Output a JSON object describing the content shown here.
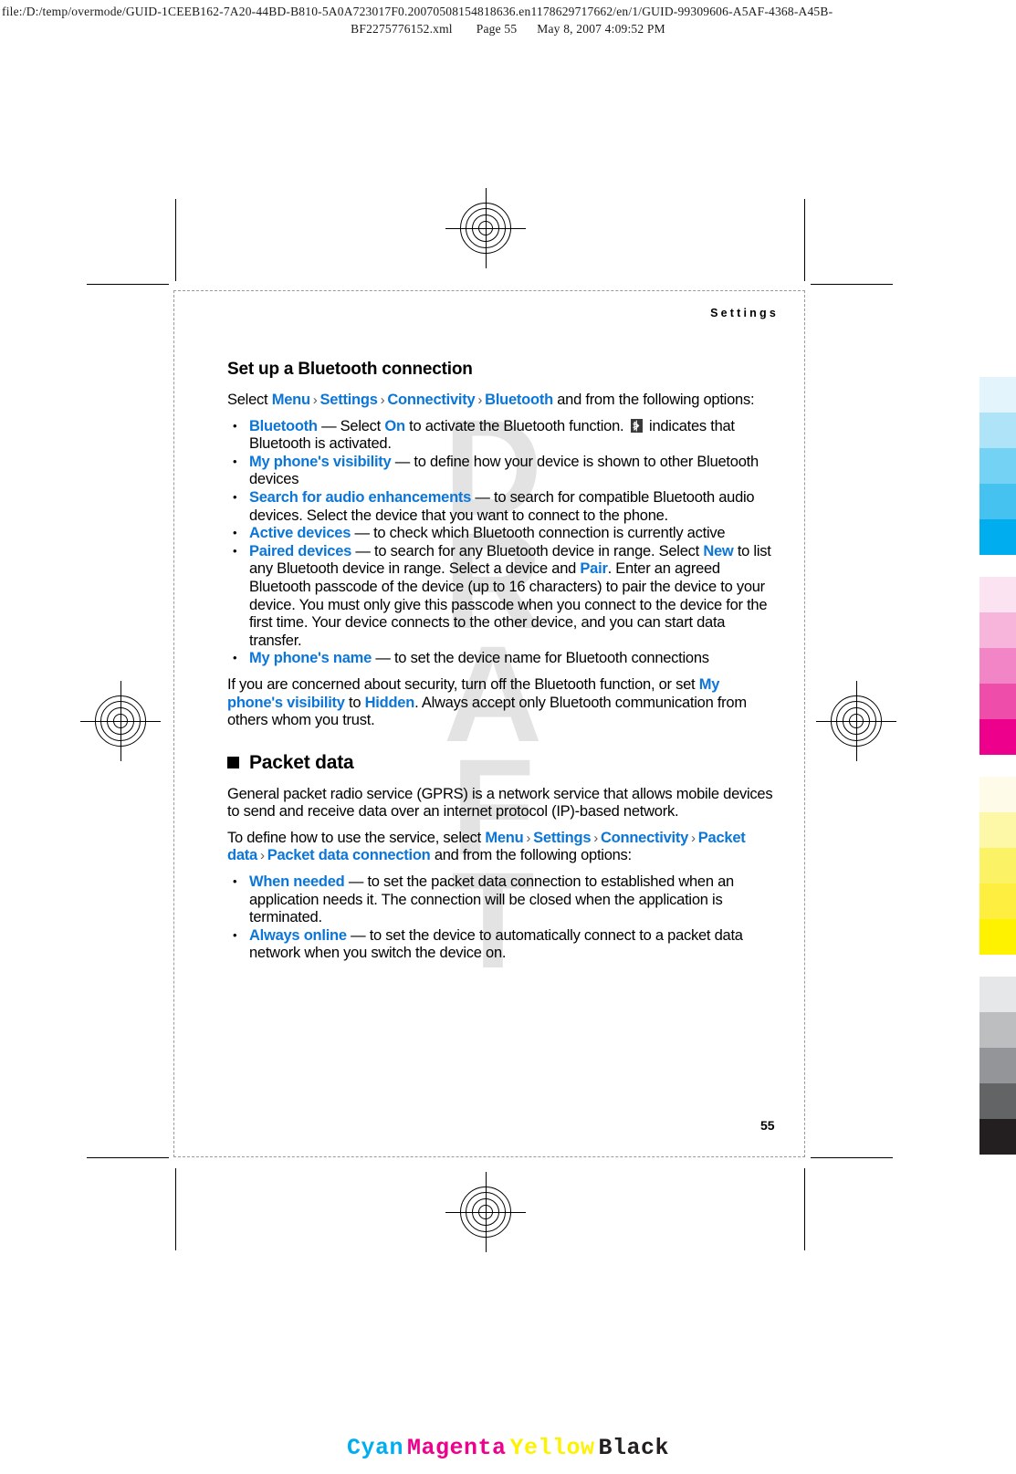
{
  "print_header": {
    "line1": "file:/D:/temp/overmode/GUID-1CEEB162-7A20-44BD-B810-5A0A723017F0.20070508154818636.en1178629717662/en/1/GUID-99309606-A5AF-4368-A45B-",
    "filename": "BF2275776152.xml",
    "page_label": "Page 55",
    "timestamp": "May 8, 2007 4:09:52 PM"
  },
  "watermark": {
    "text": "DRAFT"
  },
  "page": {
    "running_head": "Settings",
    "folio": "55",
    "section_title": "Set up a Bluetooth connection",
    "intro": {
      "prefix": "Select ",
      "path": [
        "Menu",
        "Settings",
        "Connectivity",
        "Bluetooth"
      ],
      "suffix": " and from the following options:"
    },
    "bluetooth_bullets": [
      {
        "term": "Bluetooth",
        "dash": " — ",
        "body_1": "Select ",
        "inline_key": "On",
        "body_2": " to activate the Bluetooth function. ",
        "icon": "bluetooth-icon",
        "body_3": " indicates that Bluetooth is activated."
      },
      {
        "term": "My phone's visibility",
        "dash": " — ",
        "body_1": "to define how your device is shown to other Bluetooth devices"
      },
      {
        "term": "Search for audio enhancements",
        "dash": " — ",
        "body_1": "to search for compatible Bluetooth audio devices. Select the device that you want to connect to the phone."
      },
      {
        "term": "Active devices",
        "dash": " — ",
        "body_1": "to check which Bluetooth connection is currently active"
      },
      {
        "term": "Paired devices",
        "dash": " — ",
        "body_1": "to search for any Bluetooth device in range. Select ",
        "inline_key": "New",
        "body_2": " to list any Bluetooth device in range. Select a device and ",
        "inline_key_2": "Pair",
        "body_3": ". Enter an agreed Bluetooth passcode of the device (up to 16 characters) to pair the device to your device. You must only give this passcode when you connect to the device for the first time. Your device connects to the other device, and you can start data transfer."
      },
      {
        "term": "My phone's name",
        "dash": " — ",
        "body_1": "to set the device name for Bluetooth connections"
      }
    ],
    "security_note": {
      "part_1": "If you are concerned about security, turn off the Bluetooth function, or set ",
      "key_1": "My phone's visibility",
      "part_2": " to ",
      "key_2": "Hidden",
      "part_3": ". Always accept only Bluetooth communication from others whom you trust."
    },
    "packet_data": {
      "title": "Packet data",
      "intro": "General packet radio service (GPRS) is a network service that allows mobile devices to send and receive data over an internet protocol (IP)-based network.",
      "path_intro_prefix": "To define how to use the service, select ",
      "path": [
        "Menu",
        "Settings",
        "Connectivity",
        "Packet data",
        "Packet data connection"
      ],
      "path_suffix": " and from the following options:",
      "bullets": [
        {
          "term": "When needed",
          "dash": " — ",
          "body_1": "to set the packet data connection to established when an application needs it. The connection will be closed when the application is terminated."
        },
        {
          "term": "Always online",
          "dash": " — ",
          "body_1": "to set the device to automatically connect to a packet data network when you switch the device on."
        }
      ]
    }
  },
  "color_bars": {
    "groups": [
      {
        "name": "cyan",
        "swatches": [
          "#e4f4fc",
          "#aee3f8",
          "#74d3f5",
          "#45c2ef",
          "#00aeef"
        ]
      },
      {
        "name": "magenta",
        "swatches": [
          "#fbe3f1",
          "#f8b5dc",
          "#f285c5",
          "#ee4eaa",
          "#ec008c"
        ]
      },
      {
        "name": "yellow",
        "swatches": [
          "#fefce8",
          "#fdf7a8",
          "#fcf266",
          "#fdee40",
          "#fff200"
        ]
      },
      {
        "name": "black",
        "swatches": [
          "#e6e7e8",
          "#bcbec0",
          "#939598",
          "#636466",
          "#231f20"
        ]
      }
    ]
  },
  "cmyk_footer": {
    "items": [
      {
        "label": "Cyan",
        "color": "#00aeef"
      },
      {
        "label": "Magenta",
        "color": "#ec008c"
      },
      {
        "label": "Yellow",
        "color": "#fff200"
      },
      {
        "label": "Black",
        "color": "#231f20"
      }
    ]
  }
}
